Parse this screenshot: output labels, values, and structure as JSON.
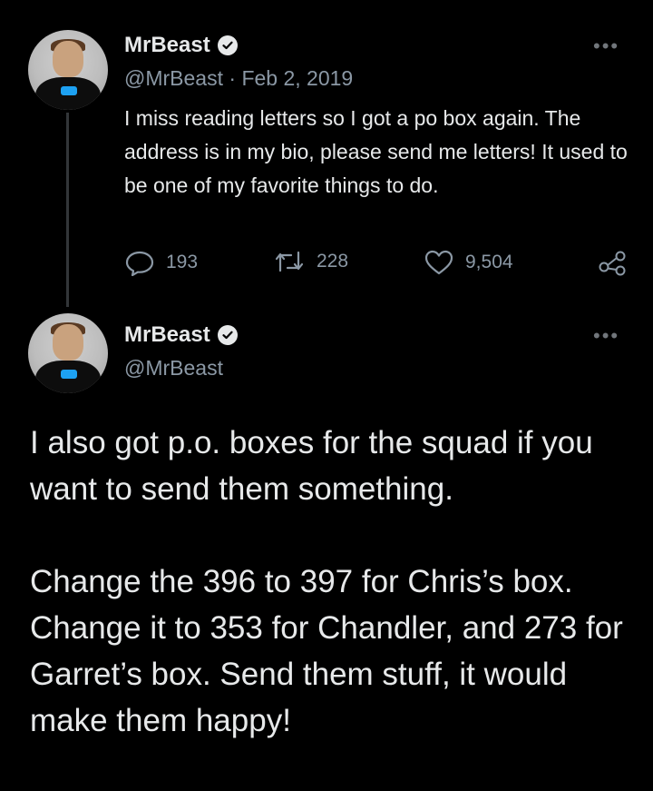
{
  "tweet1": {
    "author_name": "MrBeast",
    "handle": "@MrBeast",
    "separator": "·",
    "date": "Feb 2, 2019",
    "text": "I miss reading letters so I got a po box again. The address is in my bio, please send me letters! It used to be one of my favorite things to do.",
    "replies": "193",
    "retweets": "228",
    "likes": "9,504",
    "more": "•••"
  },
  "tweet2": {
    "author_name": "MrBeast",
    "handle": "@MrBeast",
    "more": "•••",
    "paragraph1": "I also got p.o. boxes for the squad if you want to send them something.",
    "paragraph2": "Change the 396 to 397 for Chris’s box. Change it to 353 for Chandler, and 273 for Garret’s box. Send them stuff, it would make them happy!"
  },
  "colors": {
    "background": "#000000",
    "text": "#e7e9ea",
    "secondary": "#8b98a5",
    "thread_line": "#333639"
  },
  "icons": [
    "verified-badge-icon",
    "more-icon",
    "reply-icon",
    "retweet-icon",
    "like-icon",
    "share-icon"
  ]
}
